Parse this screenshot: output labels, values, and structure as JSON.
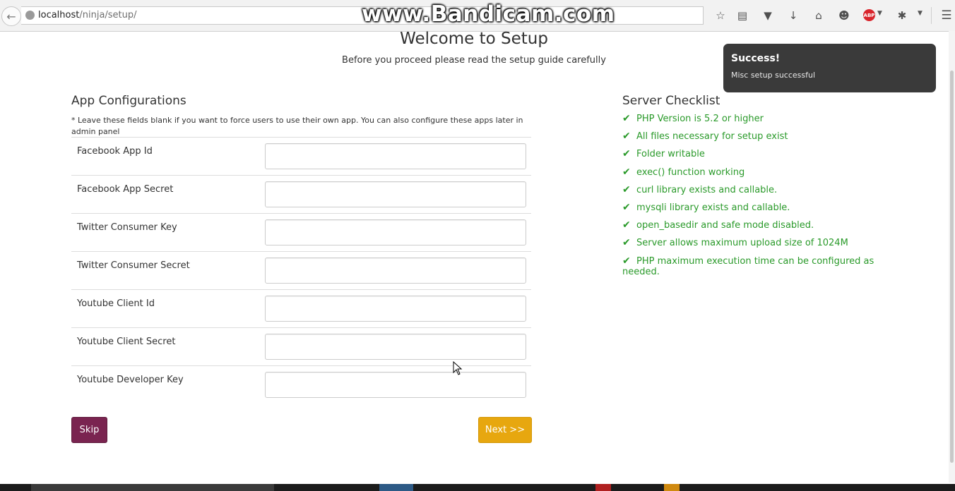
{
  "browser": {
    "url_host": "localhost",
    "url_path": "/ninja/setup/",
    "watermark": "www.Bandicam.com",
    "abp_label": "ABP"
  },
  "header": {
    "title": "Welcome to Setup",
    "subtitle": "Before you proceed please read the setup guide carefully"
  },
  "app_config": {
    "title": "App Configurations",
    "note": "* Leave these fields blank if you want to force users to use their own app. You can also configure these apps later in admin panel",
    "fields": [
      {
        "label": "Facebook App Id",
        "value": ""
      },
      {
        "label": "Facebook App Secret",
        "value": ""
      },
      {
        "label": "Twitter Consumer Key",
        "value": ""
      },
      {
        "label": "Twitter Consumer Secret",
        "value": ""
      },
      {
        "label": "Youtube Client Id",
        "value": ""
      },
      {
        "label": "Youtube Client Secret",
        "value": ""
      },
      {
        "label": "Youtube Developer Key",
        "value": ""
      }
    ],
    "skip_label": "Skip",
    "next_label": "Next >>"
  },
  "server_checklist": {
    "title": "Server Checklist",
    "items": [
      "PHP Version is 5.2 or higher",
      "All files necessary for setup exist",
      "Folder writable",
      "exec() function working",
      "curl library exists and callable.",
      "mysqli library exists and callable.",
      "open_basedir and safe mode disabled.",
      "Server allows maximum upload size of 1024M",
      "PHP maximum execution time can be configured as needed."
    ],
    "check_color": "#2a9a2a"
  },
  "toast": {
    "title": "Success!",
    "message": "Misc setup successful"
  },
  "colors": {
    "skip_button": "#7a2450",
    "next_button": "#e7a70f",
    "toast_bg": "#3a3a3a"
  }
}
